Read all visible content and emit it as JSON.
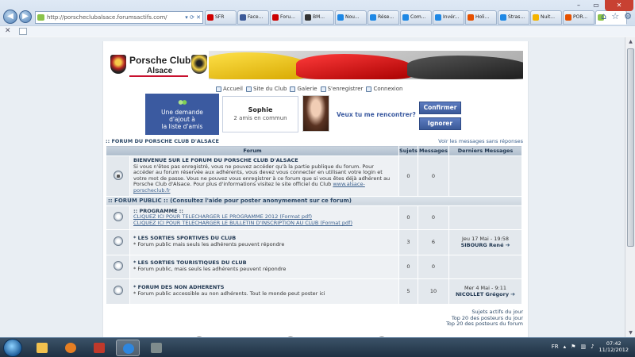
{
  "browser": {
    "url": "http://porscheclubalsace.forumsactifs.com/",
    "tabs": [
      {
        "label": "SFR",
        "color": "#d00000"
      },
      {
        "label": "Face...",
        "color": "#3b5998"
      },
      {
        "label": "Foru...",
        "color": "#cc0000"
      },
      {
        "label": "BM...",
        "color": "#333333"
      },
      {
        "label": "Nou...",
        "color": "#1e88e5"
      },
      {
        "label": "Rése...",
        "color": "#1e88e5"
      },
      {
        "label": "Com...",
        "color": "#1e88e5"
      },
      {
        "label": "Invér...",
        "color": "#1e88e5"
      },
      {
        "label": "Holi...",
        "color": "#e65100"
      },
      {
        "label": "Stras...",
        "color": "#1e88e5"
      },
      {
        "label": "Nuit...",
        "color": "#f4b400"
      },
      {
        "label": "POR...",
        "color": "#e65100"
      },
      {
        "label": "",
        "color": "#8bc34a"
      }
    ]
  },
  "site": {
    "logo_line1": "Porsche Club",
    "logo_line2": "Alsace",
    "nav": [
      {
        "label": "Accueil"
      },
      {
        "label": "Site du Club"
      },
      {
        "label": "Galerie"
      },
      {
        "label": "S'enregistrer"
      },
      {
        "label": "Connexion"
      }
    ]
  },
  "friend_request": {
    "line1": "Une demande",
    "line2": "d'ajout à",
    "line3": "la liste d'amis",
    "name": "Sophie",
    "common": "2 amis en commun",
    "question": "Veux tu me rencontrer?",
    "confirm": "Confirmer",
    "ignore": "Ignorer"
  },
  "forum": {
    "heading": ":: FORUM DU PORSCHE CLUB D'ALSACE",
    "no_reply_link": "Voir les messages sans réponses",
    "columns": {
      "forum": "Forum",
      "topics": "Sujets",
      "messages": "Messages",
      "last": "Derniers Messages"
    },
    "welcome": {
      "title": "BIENVENUE SUR LE FORUM DU PORSCHE CLUB D'ALSACE",
      "desc": "Si vous n'êtes pas enregistré, vous ne pouvez accéder qu'à la partie publique du forum. Pour accéder au forum réservée aux adhérents, vous devez vous connecter en utilisant votre login et votre mot de passe. Vous ne pouvez vous enregistrer à ce forum que si vous êtes déjà adhérent au Porsche Club d'Alsace. Pour plus d'informations visitez le site officiel du Club",
      "link": "www.alsace-porscheclub.fr",
      "topics": "0",
      "messages": "0"
    },
    "category": ":: FORUM PUBLIC :: (Consultez l'aide pour poster anonymement sur ce forum)",
    "programme": {
      "title": ":: PROGRAMME ::",
      "link1": "CLIQUEZ ICI POUR TELECHARGER LE PROGRAMME 2012 (Format pdf)",
      "link2": "CLIQUEZ ICI POUR TELECHARGER LE BULLETIN D'INSCRIPTION AU CLUB (Format pdf)",
      "topics": "0",
      "messages": "0"
    },
    "sorties_sportives": {
      "title": "* LES SORTIES SPORTIVES DU CLUB",
      "desc": "* Forum public mais seuls les adhérents peuvent répondre",
      "topics": "3",
      "messages": "6",
      "last_date": "Jeu 17 Mai - 19:58",
      "last_user": "SIBOURG René"
    },
    "sorties_touristiques": {
      "title": "* LES SORTIES TOURISTIQUES DU CLUB",
      "desc": "* Forum public, mais seuls les adhérents peuvent répondre",
      "topics": "0",
      "messages": "0"
    },
    "non_adherents": {
      "title": "* FORUM DES NON ADHERENTS",
      "desc": "* Forum public accessible au non adhérents. Tout le monde peut poster ici",
      "topics": "5",
      "messages": "10",
      "last_date": "Mer 4 Mai - 9:11",
      "last_user": "NICOLLET Grégory"
    },
    "bottom_links": [
      "Sujets actifs du jour",
      "Top 20 des posteurs du jour",
      "Top 20 des posteurs du forum"
    ]
  },
  "taskbar": {
    "lang": "FR",
    "time": "07:42",
    "date": "11/12/2012"
  }
}
